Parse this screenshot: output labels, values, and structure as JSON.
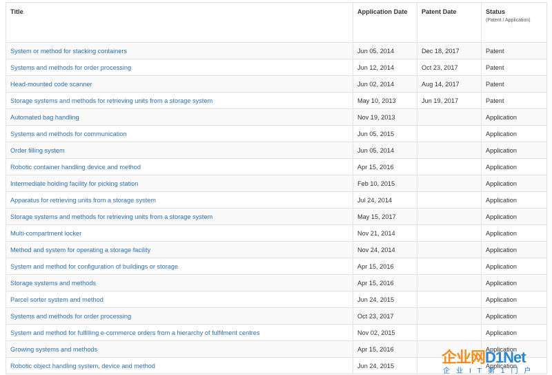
{
  "headers": {
    "title": "Title",
    "application_date": "Application Date",
    "patent_date": "Patent Date",
    "status": "Status",
    "status_sub": "(Patent / Application)"
  },
  "rows": [
    {
      "title": "System or method for stacking containers",
      "app": "Jun 05, 2014",
      "pat": "Dec 18, 2017",
      "status": "Patent"
    },
    {
      "title": "Systems and methods for order processing",
      "app": "Jun 12, 2014",
      "pat": "Oct 23, 2017",
      "status": "Patent"
    },
    {
      "title": "Head-mounted code scanner",
      "app": "Jun 02, 2014",
      "pat": "Aug 14, 2017",
      "status": "Patent"
    },
    {
      "title": "Storage systems and methods for retrieving units from a storage system",
      "app": "May 10, 2013",
      "pat": "Jun 19, 2017",
      "status": "Patent"
    },
    {
      "title": "Automated bag handling",
      "app": "Nov 19, 2013",
      "pat": "",
      "status": "Application"
    },
    {
      "title": "Systems and methods for communication",
      "app": "Jun 05, 2015",
      "pat": "",
      "status": "Application"
    },
    {
      "title": "Order filling system",
      "app": "Jun 05, 2014",
      "pat": "",
      "status": "Application"
    },
    {
      "title": "Robotic container handling device and method",
      "app": "Apr 15, 2016",
      "pat": "",
      "status": "Application"
    },
    {
      "title": "Intermediate holding facility for picking station",
      "app": "Feb 10, 2015",
      "pat": "",
      "status": "Application"
    },
    {
      "title": "Apparatus for retrieving units from a storage system",
      "app": "Jul 24, 2014",
      "pat": "",
      "status": "Application"
    },
    {
      "title": "Storage systems and methods for retrieving units from a storage system",
      "app": "May 15, 2017",
      "pat": "",
      "status": "Application"
    },
    {
      "title": "Multi-compartment locker",
      "app": "Nov 21, 2014",
      "pat": "",
      "status": "Application"
    },
    {
      "title": "Method and system for operating a storage facility",
      "app": "Nov 24, 2014",
      "pat": "",
      "status": "Application"
    },
    {
      "title": "System and method for configuration of buildings or storage",
      "app": "Apr 15, 2016",
      "pat": "",
      "status": "Application"
    },
    {
      "title": "Storage systems and methods",
      "app": "Apr 15, 2016",
      "pat": "",
      "status": "Application"
    },
    {
      "title": "Parcel sorter system and method",
      "app": "Jun 24, 2015",
      "pat": "",
      "status": "Application"
    },
    {
      "title": "Systems and methods for order processing",
      "app": "Oct 23, 2017",
      "pat": "",
      "status": "Application"
    },
    {
      "title": "System and method for fulfilling e-commerce orders from a hierarchy of fulfilment centres",
      "app": "Nov 02, 2015",
      "pat": "",
      "status": "Application"
    },
    {
      "title": "Growing systems and methods",
      "app": "Apr 15, 2016",
      "pat": "",
      "status": "Application"
    },
    {
      "title": "Robotic object handling system, device and method",
      "app": "Jun 24, 2015",
      "pat": "",
      "status": "Application"
    }
  ],
  "watermark": {
    "main_a": "企业网",
    "main_b": "D1Net",
    "sub": "企业IT第1门户"
  }
}
